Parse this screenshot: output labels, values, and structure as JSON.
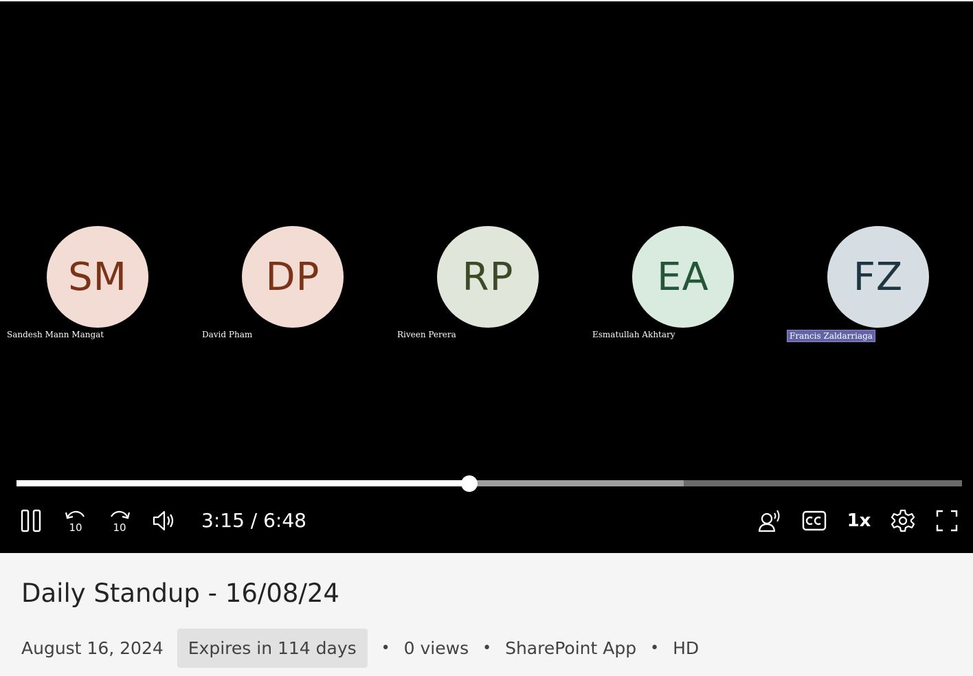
{
  "player": {
    "participants": [
      {
        "initials": "SM",
        "name": "Sandesh Mann Mangat",
        "avatar_bg": "#f2dcd3",
        "initials_color": "#7a3318",
        "active": false
      },
      {
        "initials": "DP",
        "name": "David Pham",
        "avatar_bg": "#f2dcd3",
        "initials_color": "#7a3318",
        "active": false
      },
      {
        "initials": "RP",
        "name": "Riveen Perera",
        "avatar_bg": "#e0e6da",
        "initials_color": "#3d4a28",
        "active": false
      },
      {
        "initials": "EA",
        "name": "Esmatullah Akhtary",
        "avatar_bg": "#d9ebde",
        "initials_color": "#255639",
        "active": false
      },
      {
        "initials": "FZ",
        "name": "Francis Zaldarriaga",
        "avatar_bg": "#d6dee3",
        "initials_color": "#1e3542",
        "active": true
      }
    ],
    "progress": {
      "played_fraction": 0.479,
      "buffered_fraction": 0.706
    },
    "time_display": "3:15 / 6:48",
    "rewind_label": "10",
    "forward_label": "10",
    "speed_label": "1x",
    "icons": {
      "pause": "pause-icon",
      "rewind": "rewind-10-icon",
      "forward": "forward-10-icon",
      "volume": "volume-icon",
      "voice": "speaker-voice-icon",
      "captions": "closed-captions-icon",
      "settings": "gear-icon",
      "fullscreen": "fullscreen-icon"
    }
  },
  "info": {
    "title": "Daily Standup - 16/08/24",
    "date": "August 16, 2024",
    "expires": "Expires in 114 days",
    "views": "0 views",
    "source": "SharePoint App",
    "quality": "HD",
    "separator": "•"
  }
}
